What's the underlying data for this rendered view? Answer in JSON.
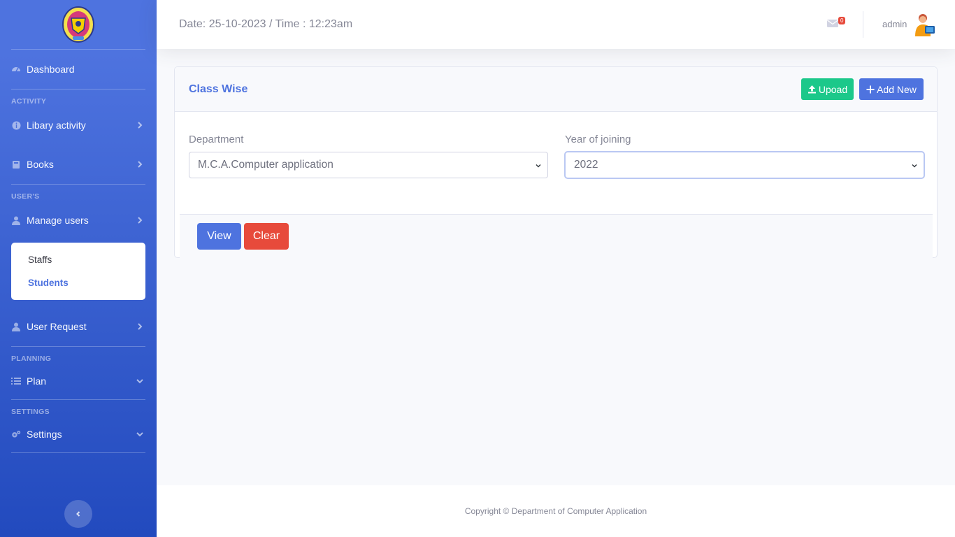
{
  "topbar": {
    "datetime": "Date: 25-10-2023 / Time : 12:23am",
    "mail_count": "0",
    "user_name": "admin"
  },
  "sidebar": {
    "dashboard": "Dashboard",
    "heading_activity": "ACTIVITY",
    "library_activity": "Libary activity",
    "books": "Books",
    "heading_users": "USER'S",
    "manage_users": "Manage users",
    "submenu": {
      "staffs": "Staffs",
      "students": "Students"
    },
    "user_request": "User Request",
    "heading_planning": "PLANNING",
    "plan": "Plan",
    "heading_settings": "SETTINGS",
    "settings": "Settings"
  },
  "card": {
    "title": "Class Wise",
    "upload_label": "Upoad",
    "add_new_label": "Add New",
    "department_label": "Department",
    "department_value": "M.C.A.Computer application",
    "year_label": "Year of joining",
    "year_value": "2022",
    "view_label": "View",
    "clear_label": "Clear"
  },
  "footer": {
    "copyright": "Copyright © Department of Computer Application"
  },
  "colors": {
    "primary": "#4e73df",
    "success": "#1cc88a",
    "danger": "#e74a3b"
  }
}
